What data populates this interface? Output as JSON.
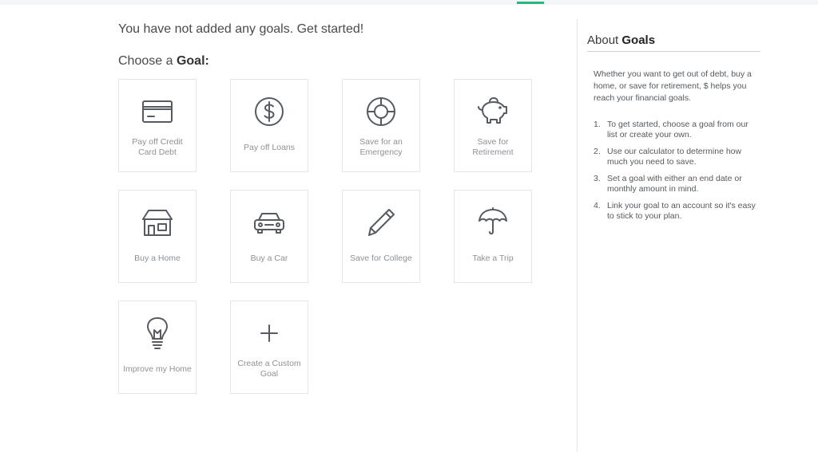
{
  "header": {
    "empty_message": "You have not added any goals. Get started!",
    "choose_prefix": "Choose a",
    "choose_bold": "Goal:"
  },
  "goals": [
    {
      "label": "Pay off Credit Card Debt",
      "icon": "credit-card-icon"
    },
    {
      "label": "Pay off Loans",
      "icon": "dollar-coin-icon"
    },
    {
      "label": "Save for an Emergency",
      "icon": "life-ring-icon"
    },
    {
      "label": "Save for Retirement",
      "icon": "piggy-bank-icon"
    },
    {
      "label": "Buy a Home",
      "icon": "house-icon"
    },
    {
      "label": "Buy a Car",
      "icon": "car-icon"
    },
    {
      "label": "Save for College",
      "icon": "pencil-icon"
    },
    {
      "label": "Take a Trip",
      "icon": "umbrella-icon"
    },
    {
      "label": "Improve my Home",
      "icon": "lightbulb-icon"
    },
    {
      "label": "Create a Custom Goal",
      "icon": "plus-icon"
    }
  ],
  "about": {
    "title_prefix": "About",
    "title_bold": "Goals",
    "intro": "Whether you want to get out of debt, buy a home, or save for retirement, $ helps you reach your financial goals.",
    "steps": [
      {
        "num": "1.",
        "text": "To get started, choose a goal from our list or create your own."
      },
      {
        "num": "2.",
        "text": "Use our calculator to determine how much you need to save."
      },
      {
        "num": "3.",
        "text": "Set a goal with either an end date or monthly amount in mind."
      },
      {
        "num": "4.",
        "text": "Link your goal to an account so it's easy to stick to your plan."
      }
    ]
  },
  "colors": {
    "accent": "#2ab77f",
    "tile_border": "#e4e5e7",
    "tile_label": "#8d9196"
  }
}
